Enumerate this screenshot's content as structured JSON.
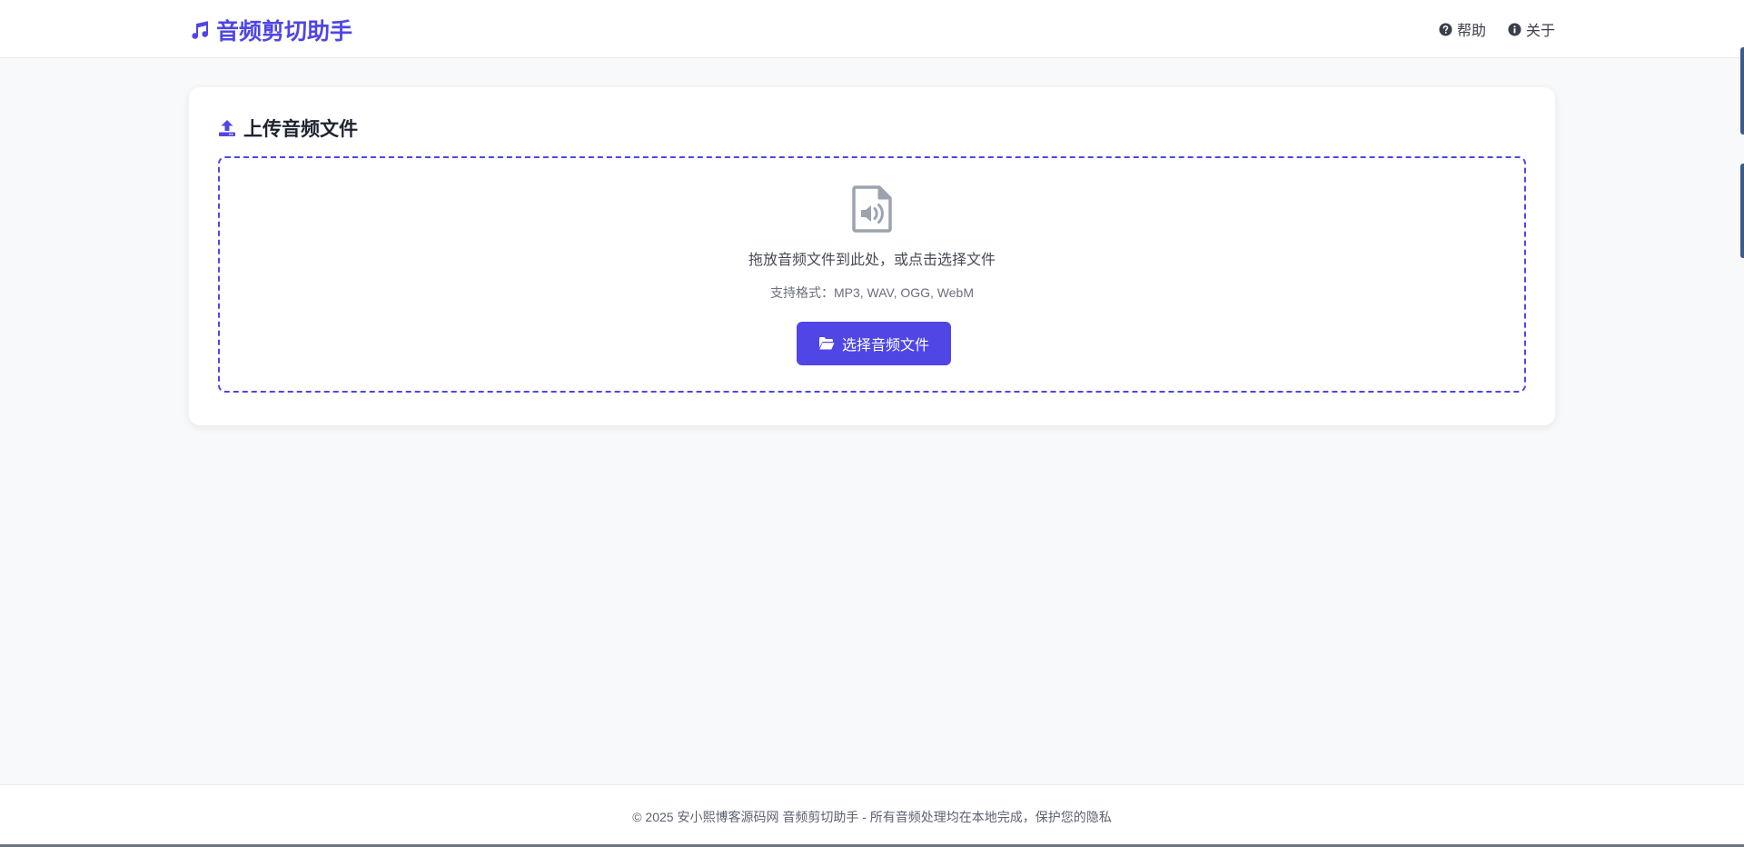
{
  "header": {
    "brand": "音频剪切助手",
    "brand_icon": "music-icon",
    "nav": [
      {
        "label": "帮助",
        "icon": "question-circle-icon"
      },
      {
        "label": "关于",
        "icon": "info-circle-icon"
      }
    ]
  },
  "upload": {
    "title": "上传音频文件",
    "title_icon": "upload-icon",
    "drop_icon": "audio-file-icon",
    "drop_text": "拖放音频文件到此处，或点击选择文件",
    "formats_text": "支持格式：MP3, WAV, OGG, WebM",
    "button_label": "选择音频文件",
    "button_icon": "folder-open-icon"
  },
  "footer": {
    "text": "© 2025 安小熙博客源码网 音频剪切助手 - 所有音频处理均在本地完成，保护您的隐私"
  },
  "colors": {
    "accent": "#4f46e5",
    "page_bg": "#f8f9fb",
    "card_bg": "#ffffff",
    "muted_icon": "#9ca3af"
  }
}
